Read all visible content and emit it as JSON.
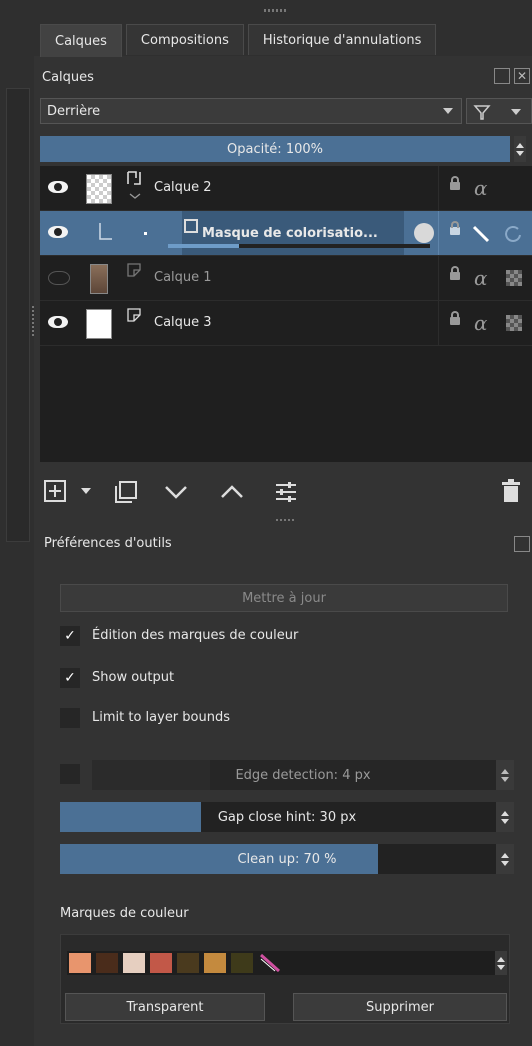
{
  "tabs": [
    {
      "label": "Calques",
      "active": true
    },
    {
      "label": "Compositions",
      "active": false
    },
    {
      "label": "Historique d'annulations",
      "active": false
    }
  ],
  "layers_panel": {
    "title": "Calques",
    "blend_mode": "Derrière",
    "opacity": "Opacité: 100%",
    "layers": [
      {
        "name": "Calque 2",
        "visible": true,
        "thumb": "checker",
        "selected": false
      },
      {
        "name": "Masque de colorisatio...",
        "visible": true,
        "thumb": "none",
        "selected": true,
        "progress_fraction": 0.27
      },
      {
        "name": "Calque 1",
        "visible": false,
        "thumb": "photo",
        "selected": false
      },
      {
        "name": "Calque 3",
        "visible": true,
        "thumb": "white",
        "selected": false
      }
    ],
    "alpha_symbol": "α"
  },
  "toolbar": {
    "icons": [
      "add-layer-icon",
      "dropdown-icon",
      "duplicate-icon",
      "move-down-icon",
      "move-up-icon",
      "properties-icon",
      "delete-icon"
    ]
  },
  "tool_prefs": {
    "title": "Préférences d'outils",
    "update_button": "Mettre à jour",
    "checkboxes": [
      {
        "label": "Édition des marques de couleur",
        "checked": true
      },
      {
        "label": "Show output",
        "checked": true
      },
      {
        "label": "Limit to layer bounds",
        "checked": false
      }
    ],
    "edge_detection": {
      "label": "Edge detection: 4 px",
      "enabled": false,
      "fill_fraction": 0.28
    },
    "gap_close": {
      "label": "Gap close hint: 30 px",
      "fill_fraction": 0.31
    },
    "clean_up": {
      "label": "Clean up: 70 %",
      "fill_fraction": 0.7
    },
    "color_marks_title": "Marques de couleur",
    "swatch_colors": [
      "#e8956d",
      "#4a2c1b",
      "#e6cfc0",
      "#c25848",
      "#4a3a1e",
      "#c48a3e",
      "#3e3a1a"
    ],
    "transparent_button": "Transparent",
    "delete_button": "Supprimer"
  }
}
